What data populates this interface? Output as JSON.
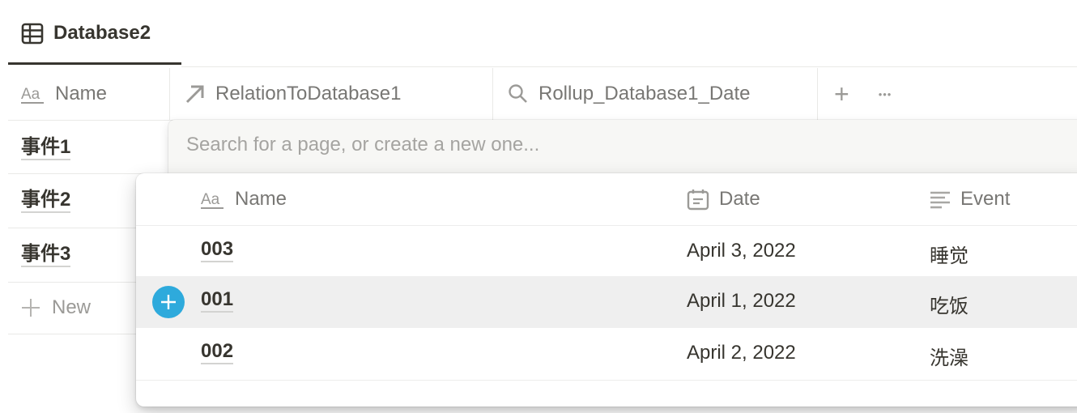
{
  "view_tab": {
    "label": "Database2",
    "icon": "table-icon"
  },
  "columns": [
    {
      "label": "Name",
      "icon": "text-title-icon"
    },
    {
      "label": "RelationToDatabase1",
      "icon": "relation-arrow-icon"
    },
    {
      "label": "Rollup_Database1_Date",
      "icon": "rollup-search-icon"
    }
  ],
  "column_actions": {
    "add": "+",
    "more": "•••"
  },
  "rows": [
    {
      "name": "事件1"
    },
    {
      "name": "事件2"
    },
    {
      "name": "事件3"
    }
  ],
  "new_row_label": "New",
  "relation_picker": {
    "search_placeholder": "Search for a page, or create a new one...",
    "search_value": "",
    "columns": [
      {
        "label": "Name",
        "icon": "text-title-icon"
      },
      {
        "label": "Date",
        "icon": "calendar-icon"
      },
      {
        "label": "Event",
        "icon": "text-lines-icon"
      }
    ],
    "items": [
      {
        "name": "003",
        "date": "April 3, 2022",
        "event": "睡觉",
        "hovered": false
      },
      {
        "name": "001",
        "date": "April 1, 2022",
        "event": "吃饭",
        "hovered": true
      },
      {
        "name": "002",
        "date": "April 2, 2022",
        "event": "洗澡",
        "hovered": false
      }
    ],
    "accent_color": "#2eaadc"
  }
}
